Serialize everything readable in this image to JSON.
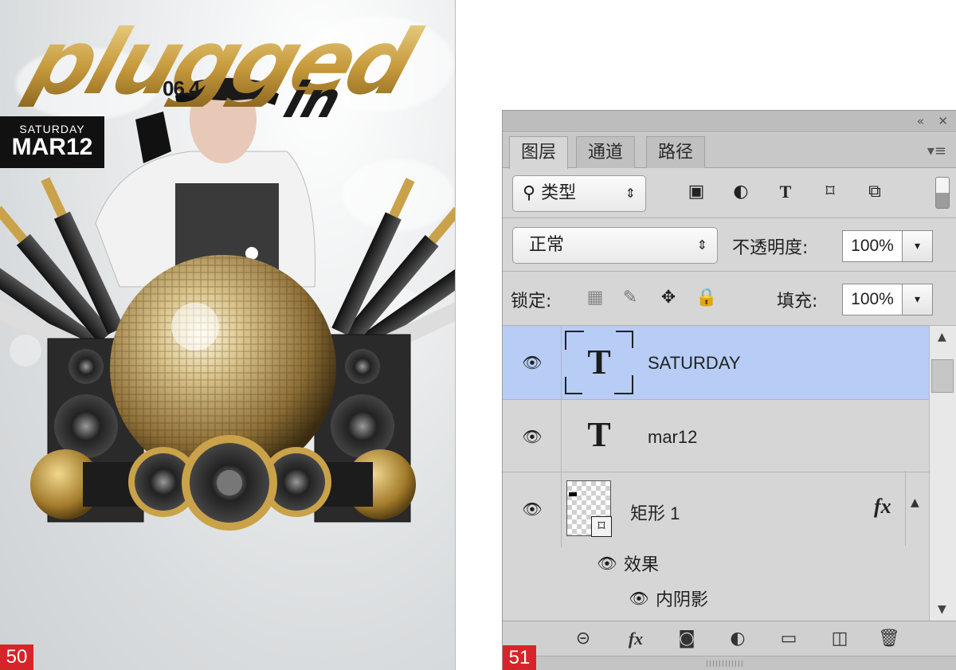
{
  "poster": {
    "title_main": "plugged",
    "title_sub": "in",
    "date_small": "06.4",
    "day_label": "SATURDAY",
    "date_label": "MAR12",
    "badge_number": "50",
    "colors": {
      "gold": "#c9a24a",
      "dark": "#111111",
      "badge": "#d6242a"
    }
  },
  "panel": {
    "badge_number": "51",
    "tabs": [
      "图层",
      "通道",
      "路径"
    ],
    "collapse_icon": "double-chevron-icon",
    "close_icon": "close-icon",
    "menu_icon": "panel-menu-icon",
    "filter": {
      "kind_label": "类型",
      "search_icon": "search-icon",
      "icons": [
        "image-filter-icon",
        "adjustment-filter-icon",
        "type-filter-icon",
        "shape-filter-icon",
        "smart-object-filter-icon"
      ]
    },
    "blend": {
      "mode": "正常",
      "opacity_label": "不透明度:",
      "opacity_value": "100%"
    },
    "lock": {
      "label": "锁定:",
      "icons": [
        "lock-transparency-icon",
        "lock-image-icon",
        "lock-position-icon",
        "lock-all-icon"
      ],
      "fill_label": "填充:",
      "fill_value": "100%"
    },
    "layers": [
      {
        "name": "SATURDAY",
        "kind": "type",
        "selected": true,
        "thumb_glyph": "T"
      },
      {
        "name": "mar12",
        "kind": "type",
        "selected": false,
        "thumb_glyph": "T"
      },
      {
        "name": "矩形 1",
        "kind": "shape",
        "selected": false,
        "fx": "fx",
        "effects_label": "效果",
        "effects": [
          "内阴影"
        ]
      }
    ],
    "bottom_icons": [
      "link-layers-icon",
      "layer-style-icon",
      "add-mask-icon",
      "new-adjustment-icon",
      "new-group-icon",
      "new-layer-icon",
      "delete-layer-icon"
    ],
    "selection_color": "#b7cdf5"
  }
}
